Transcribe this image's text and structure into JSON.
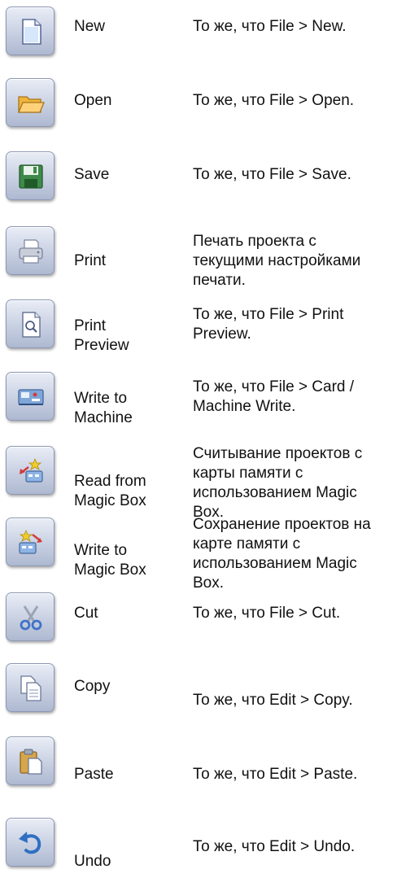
{
  "rows": [
    {
      "label": "New",
      "icon": "new-document-icon",
      "desc": "То же, что File > New."
    },
    {
      "label": "Open",
      "icon": "open-folder-icon",
      "desc": "То же, что File > Open."
    },
    {
      "label": "Save",
      "icon": "save-floppy-icon",
      "desc": "То же, что File > Save."
    },
    {
      "label": "Print",
      "icon": "printer-icon",
      "desc": "Печать проекта с\nтекущими настройками\nпечати."
    },
    {
      "label": "Print\nPreview",
      "icon": "print-preview-icon",
      "desc": "То же, что File > Print\nPreview."
    },
    {
      "label": "Write to\nMachine",
      "icon": "write-to-machine-icon",
      "desc": "То же, что File > Card /\nMachine Write."
    },
    {
      "label": "Read from\nMagic Box",
      "icon": "read-from-magic-box-icon",
      "desc": "Считывание проектов с\nкарты памяти с\nиспользованием Magic\nBox."
    },
    {
      "label": "Write to\nMagic Box",
      "icon": "write-to-magic-box-icon",
      "desc": "Сохранение проектов на\nкарте памяти с\nиспользованием Magic\nBox."
    },
    {
      "label": "Cut",
      "icon": "scissors-icon",
      "desc": "То же, что File > Cut."
    },
    {
      "label": "Copy",
      "icon": "copy-icon",
      "desc": "То же, что Edit > Copy."
    },
    {
      "label": "Paste",
      "icon": "paste-icon",
      "desc": "То же, что Edit > Paste."
    },
    {
      "label": "Undo",
      "icon": "undo-icon",
      "desc": "То же, что Edit > Undo."
    }
  ]
}
